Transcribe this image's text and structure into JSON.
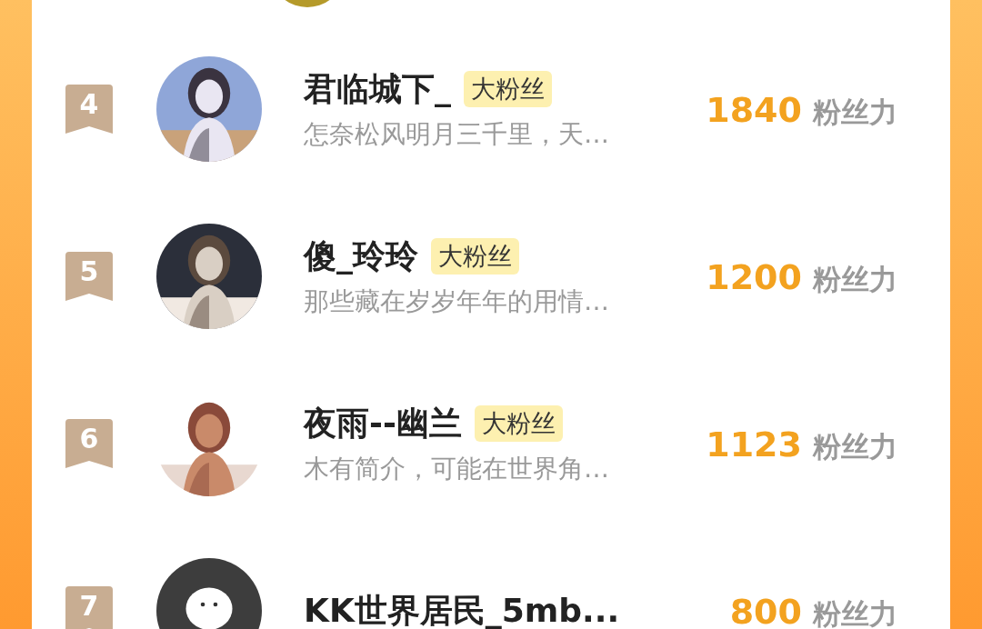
{
  "fans": [
    {
      "rank": "4",
      "name": "君临城下_",
      "badge": "大粉丝",
      "bio": "怎奈松风明月三千里，天…",
      "score": "1840",
      "score_unit": "粉丝力"
    },
    {
      "rank": "5",
      "name": "傻_玲玲",
      "badge": "大粉丝",
      "bio": "那些藏在岁岁年年的用情…",
      "score": "1200",
      "score_unit": "粉丝力"
    },
    {
      "rank": "6",
      "name": "夜雨--幽兰",
      "badge": "大粉丝",
      "bio": "木有简介，可能在世界角…",
      "score": "1123",
      "score_unit": "粉丝力"
    },
    {
      "rank": "7",
      "avatar": {
        "kind": "default"
      },
      "name": "KK世界居民_5mb...",
      "score": "800",
      "score_unit": "粉丝力"
    }
  ]
}
